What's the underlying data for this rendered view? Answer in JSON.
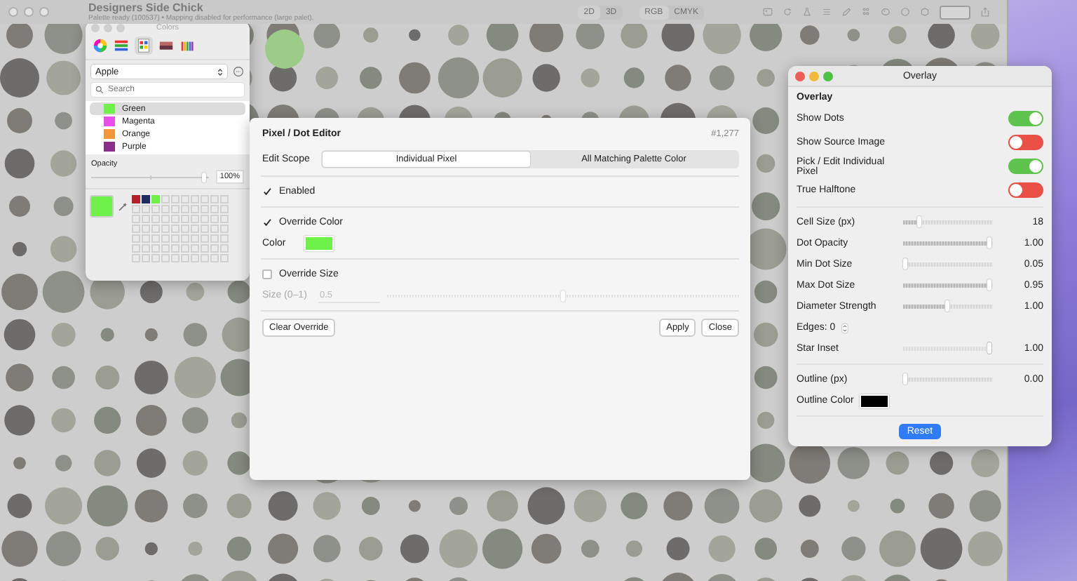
{
  "app": {
    "title": "Designers Side Chick",
    "subtitle": "Palette ready (100537)  •  Mapping disabled for performance (large palet).",
    "view_modes": [
      {
        "label": "2D",
        "selected": true
      },
      {
        "label": "3D",
        "selected": false
      }
    ],
    "color_modes": [
      {
        "label": "RGB",
        "selected": true
      },
      {
        "label": "CMYK",
        "selected": false
      }
    ]
  },
  "colors_panel": {
    "title": "Colors",
    "palette": "Apple",
    "search": {
      "placeholder": "Search"
    },
    "swatches": [
      {
        "name": "Green",
        "color": "#6ef24a",
        "selected": true
      },
      {
        "name": "Magenta",
        "color": "#e84fe8",
        "selected": false
      },
      {
        "name": "Orange",
        "color": "#f2983a",
        "selected": false
      },
      {
        "name": "Purple",
        "color": "#8a2e8c",
        "selected": false
      }
    ],
    "opacity_label": "Opacity",
    "opacity": {
      "level": 0.96
    },
    "opacity_value": "100%",
    "custom_colors": [
      {
        "color": "#b0212c"
      },
      {
        "color": "#1e2b5e"
      },
      {
        "color": "#6ef24a"
      }
    ]
  },
  "editor": {
    "title": "Pixel / Dot Editor",
    "pixel_id": "#1,277",
    "scope_label": "Edit Scope",
    "scopes": [
      {
        "label": "Individual Pixel",
        "selected": true
      },
      {
        "label": "All Matching Palette Color",
        "selected": false
      }
    ],
    "enabled": {
      "label": "Enabled",
      "checked": true
    },
    "override_color": {
      "label": "Override Color",
      "checked": true
    },
    "color_label": "Color",
    "override_size": {
      "label": "Override Size",
      "checked": false
    },
    "size_label": "Size (0–1)",
    "size_value": "0.5",
    "size_slider": {
      "level": 0.5
    },
    "buttons": [
      {
        "label": "Clear Override",
        "kind": "left"
      },
      {
        "label": "Apply",
        "kind": "right"
      },
      {
        "label": "Close",
        "kind": "right"
      }
    ]
  },
  "overlay": {
    "title": "Overlay",
    "section": "Overlay",
    "toggles": [
      {
        "label": "Show Dots",
        "on": true
      },
      {
        "label": "Show Source Image",
        "on": false
      },
      {
        "label": "Pick / Edit Individual Pixel",
        "on": true
      },
      {
        "label": "True Halftone",
        "on": false
      }
    ],
    "controls": [
      {
        "kind": "slider",
        "label": "Cell Size (px)",
        "level": 0.18,
        "value": "18",
        "disabled": false
      },
      {
        "kind": "slider",
        "label": "Dot Opacity",
        "level": 0.97,
        "value": "1.00",
        "disabled": false
      },
      {
        "kind": "slider",
        "label": "Min Dot Size",
        "level": 0.03,
        "value": "0.05",
        "disabled": false
      },
      {
        "kind": "slider",
        "label": "Max Dot Size",
        "level": 0.97,
        "value": "0.95",
        "disabled": false
      },
      {
        "kind": "slider",
        "label": "Diameter Strength",
        "level": 0.5,
        "value": "1.00",
        "disabled": false
      },
      {
        "kind": "stepper",
        "label": "Edges: 0"
      },
      {
        "kind": "slider",
        "label": "Star Inset",
        "level": 0.97,
        "value": "1.00",
        "disabled": true
      }
    ],
    "outline": {
      "label": "Outline (px)",
      "level": 0.03,
      "value": "0.00"
    },
    "outline_color_label": "Outline Color",
    "reset": "Reset"
  }
}
